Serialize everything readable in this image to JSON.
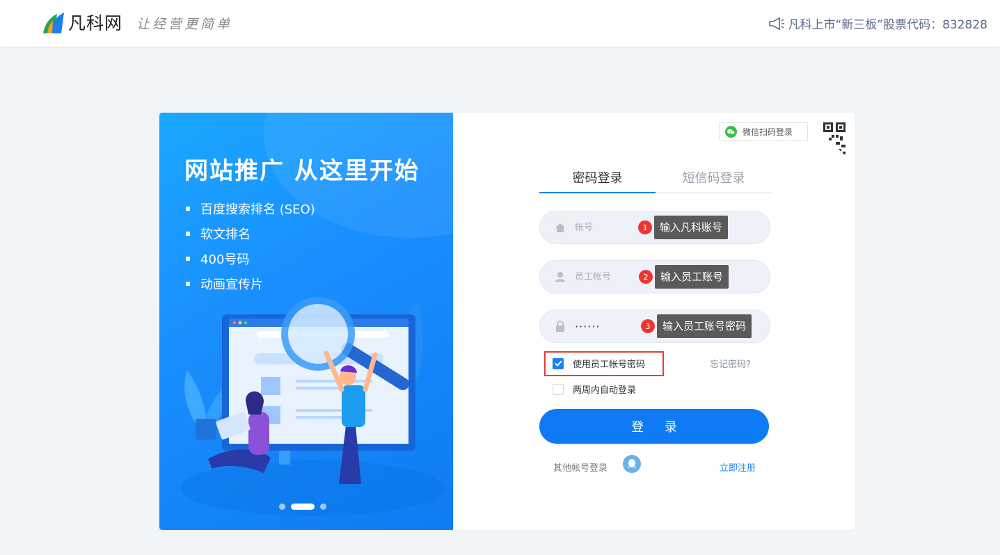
{
  "header": {
    "logo_text": "凡科网",
    "slogan": "让经营更简单",
    "notice": "凡科上市“新三板”股票代码：832828"
  },
  "banner": {
    "title": "网站推广  从这里开始",
    "features": [
      "百度搜索排名 (SEO)",
      "软文排名",
      "400号码",
      "动画宣传片"
    ]
  },
  "wechat_login_label": "微信扫码登录",
  "tabs": [
    {
      "label": "密码登录",
      "active": true
    },
    {
      "label": "短信码登录",
      "active": false
    }
  ],
  "fields": {
    "account": {
      "placeholder": "帐号",
      "tip_num": "1",
      "tip": "输入凡科账号"
    },
    "staff": {
      "placeholder": "员工帐号",
      "tip_num": "2",
      "tip": "输入员工账号"
    },
    "password": {
      "value": "······",
      "tip_num": "3",
      "tip": "输入员工账号密码"
    }
  },
  "options": {
    "use_staff": {
      "label": "使用员工帐号密码",
      "checked": true
    },
    "remember": {
      "label": "两周内自动登录",
      "checked": false
    },
    "forgot": "忘记密码？"
  },
  "login_button": "登 录",
  "other_login": "其他帐号登录",
  "register": "立即注册",
  "colors": {
    "primary": "#0e7bf5",
    "tip_red": "#ee3535",
    "banner": "#1a8fff"
  }
}
